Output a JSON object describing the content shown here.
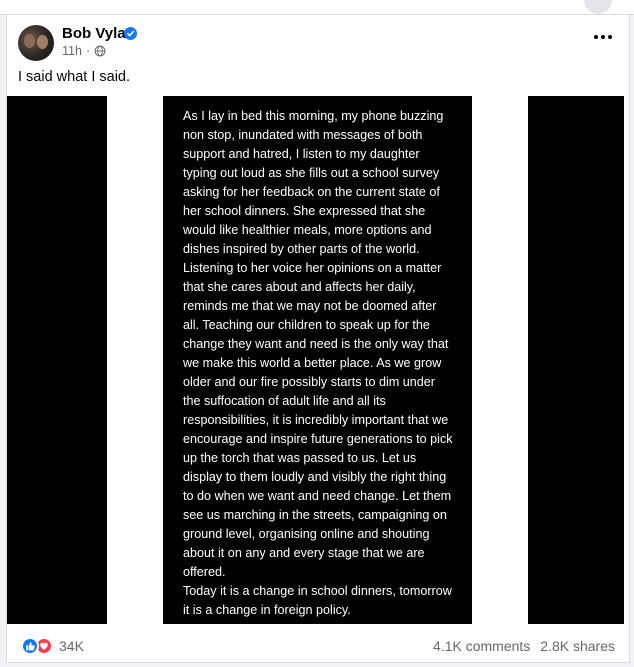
{
  "post": {
    "author": "Bob Vylan",
    "time": "11h",
    "caption": "I said what I said.",
    "story_text": "As I lay in bed this morning, my phone buzzing\nnon stop, inundated with messages of both\nsupport and hatred, I listen to my daughter\ntyping out loud as she fills out a school survey\nasking for her feedback on the current state of\nher school dinners. She expressed that she\nwould like healthier meals, more options and\ndishes inspired by other parts of the world.\nListening to her voice her opinions on a matter\nthat she cares about and affects her daily,\nreminds me that we may not be doomed after\nall. Teaching our children to speak up for the\nchange they want and need is the only way that\nwe make this world a better place. As we grow\nolder and our fire possibly starts to dim under\nthe suffocation of adult life and all its\nresponsibilities, it is incredibly important that we\nencourage and inspire future generations to pick\nup the torch that was passed to us. Let us\ndisplay to them loudly and visibly the right thing\nto do when we want and need change. Let them\nsee us marching in the streets, campaigning on\nground level, organising online and shouting\nabout it on any and every stage that we are\noffered.\nToday it is a change in school dinners, tomorrow\nit is a change in foreign policy."
  },
  "footer": {
    "reaction_count": "34K",
    "comments": "4.1K comments",
    "shares": "2.8K shares"
  },
  "icons": {
    "verified": "verified-badge-icon",
    "privacy": "globe-icon",
    "menu": "more-options-icon",
    "like": "like-icon",
    "love": "love-icon"
  },
  "colors": {
    "brand_blue": "#1877f2",
    "love_red": "#f33e58",
    "secondary_text": "#65676b"
  }
}
